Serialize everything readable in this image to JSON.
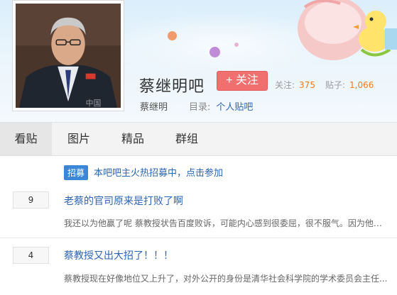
{
  "forum": {
    "name": "蔡继明吧",
    "follow_label": "+ 关注",
    "stats": {
      "followers_label": "关注:",
      "followers_value": "375",
      "posts_label": "贴子:",
      "posts_value": "1,066"
    },
    "subtitle": {
      "owner_name": "蔡继明",
      "directory_label": "目录:",
      "directory_value": "个人贴吧"
    },
    "avatar_watermark": "中国"
  },
  "nav": {
    "tabs": [
      {
        "label": "看贴",
        "active": true
      },
      {
        "label": "图片",
        "active": false
      },
      {
        "label": "精品",
        "active": false
      },
      {
        "label": "群组",
        "active": false
      }
    ]
  },
  "recruit": {
    "tag": "招募",
    "text": "本吧吧主火热招募中，点击参加"
  },
  "threads": [
    {
      "reply_count": "9",
      "title": "老蔡的官司原来是打败了啊",
      "abstract": "我还以为他赢了呢 蔡教授状告百度败诉，可能内心感到很委屈，很不服气。因为他遭..."
    },
    {
      "reply_count": "4",
      "title": "蔡教授又出大招了！！！",
      "abstract": "蔡教授现在好像地位又上升了，对外公开的身份是清华社会科学院的学术委员会主任..."
    }
  ],
  "colors": {
    "accent_red": "#f06f6f",
    "link_blue": "#2d64b3",
    "stat_orange": "#f27c22",
    "tag_blue": "#3b86d6"
  }
}
